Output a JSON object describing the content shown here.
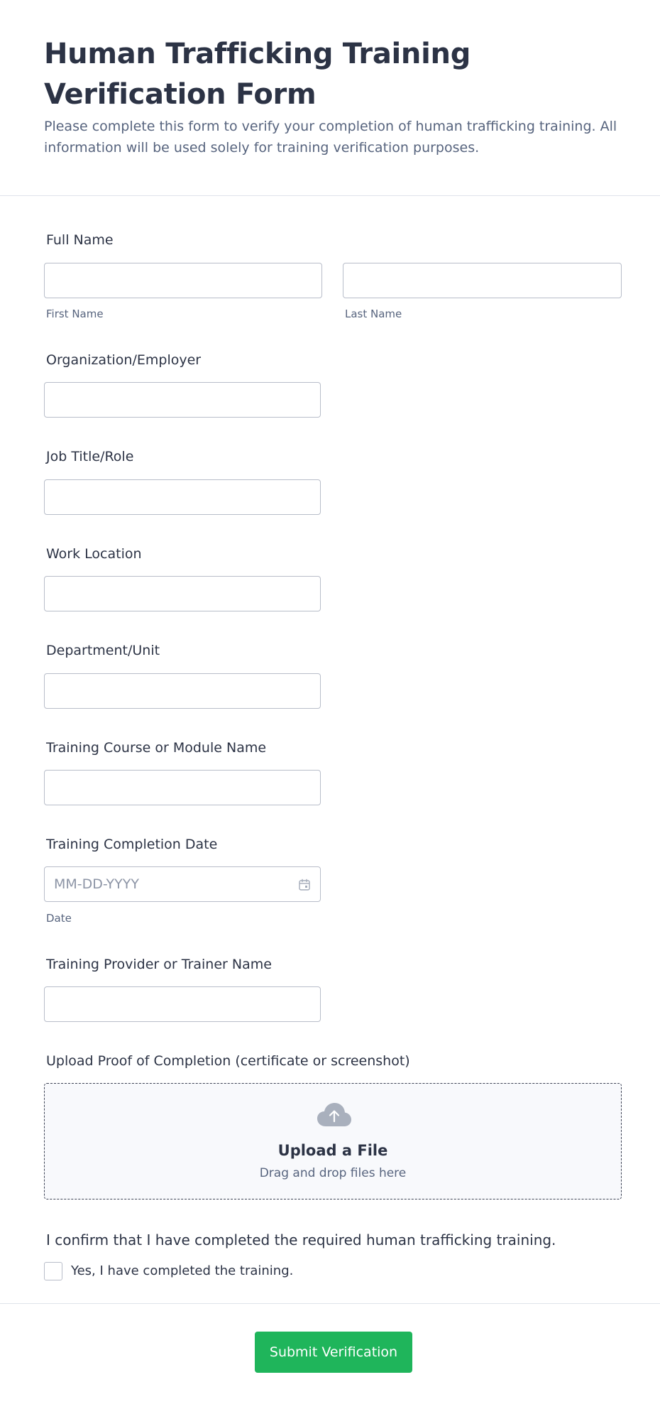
{
  "form": {
    "title": "Human Trafficking Training Verification Form",
    "description": "Please complete this form to verify your completion of human trafficking training. All information will be used solely for training verification purposes."
  },
  "fields": {
    "full_name": {
      "label": "Full Name",
      "first_sublabel": "First Name",
      "last_sublabel": "Last Name"
    },
    "organization": {
      "label": "Organization/Employer"
    },
    "job_title": {
      "label": "Job Title/Role"
    },
    "work_location": {
      "label": "Work Location"
    },
    "department": {
      "label": "Department/Unit"
    },
    "course_name": {
      "label": "Training Course or Module Name"
    },
    "completion_date": {
      "label": "Training Completion Date",
      "placeholder": "MM-DD-YYYY",
      "sublabel": "Date",
      "icon": "calendar-icon"
    },
    "provider": {
      "label": "Training Provider or Trainer Name"
    },
    "upload": {
      "label": "Upload Proof of Completion (certificate or screenshot)",
      "title": "Upload a File",
      "subtitle": "Drag and drop files here",
      "icon": "cloud-upload-icon"
    },
    "confirmation": {
      "label": "I confirm that I have completed the required human trafficking training.",
      "option": "Yes, I have completed the training.",
      "checked": false
    }
  },
  "submit": {
    "label": "Submit Verification",
    "color": "#1fb55b"
  },
  "colors": {
    "text": "#2c3345",
    "muted": "#57647e",
    "border": "#b8bdc9"
  }
}
